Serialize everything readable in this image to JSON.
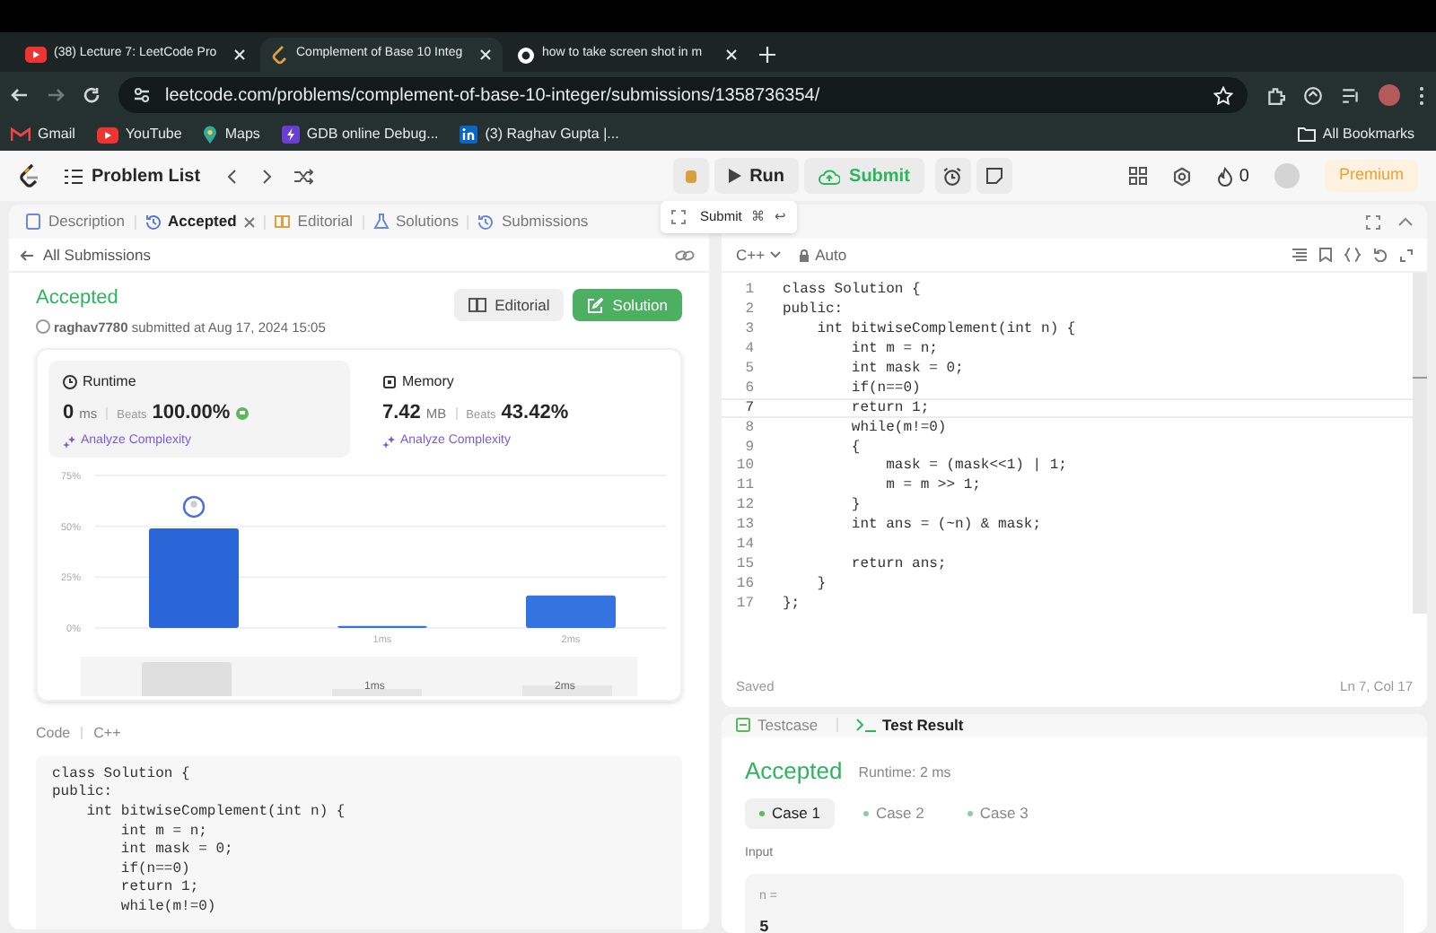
{
  "browser": {
    "tabs": [
      {
        "title": "(38) Lecture 7: LeetCode Pro",
        "kind": "video",
        "selected": false
      },
      {
        "title": "Complement of Base 10 Integ",
        "kind": "leetcode",
        "selected": true
      },
      {
        "title": "how to take screen shot in m",
        "kind": "search",
        "selected": false
      }
    ],
    "url": "leetcode.com/problems/complement-of-base-10-integer/submissions/1358736354/",
    "bookmarks": [
      {
        "label": "Gmail",
        "kind": "mail"
      },
      {
        "label": "YouTube",
        "kind": "video"
      },
      {
        "label": "Maps",
        "kind": "pin"
      },
      {
        "label": "GDB online Debug...",
        "kind": "bolt"
      },
      {
        "label": "(3) Raghav Gupta |...",
        "kind": "in"
      }
    ],
    "all_bookmarks": "All Bookmarks"
  },
  "navbar": {
    "problem_list": "Problem List",
    "run": "Run",
    "submit": "Submit",
    "streak": "0",
    "premium": "Premium"
  },
  "left_panel": {
    "tabs": [
      {
        "label": "Description",
        "selected": false,
        "closable": false
      },
      {
        "label": "Accepted",
        "selected": true,
        "closable": true
      },
      {
        "label": "Editorial",
        "selected": false,
        "closable": false
      },
      {
        "label": "Solutions",
        "selected": false,
        "closable": false
      },
      {
        "label": "Submissions",
        "selected": false,
        "closable": false
      }
    ],
    "back_link": "All Submissions",
    "status": "Accepted",
    "submitted": "**raghav7780** submitted at Aug 17, 2024 15:05",
    "buttons": [
      {
        "label": "Editorial",
        "kind": "secondary"
      },
      {
        "label": "Solution",
        "kind": "primary"
      }
    ],
    "stats": [
      {
        "title": "Runtime",
        "value": "0",
        "unit": "ms",
        "beats_label": "Beats",
        "beats": "100.00%",
        "analyze": "Analyze Complexity",
        "selected": true
      },
      {
        "title": "Memory",
        "value": "7.42",
        "unit": "MB",
        "beats_label": "Beats",
        "beats": "43.42%",
        "analyze": "Analyze Complexity",
        "selected": false
      }
    ],
    "chart_data": {
      "type": "bar",
      "categories": [
        null,
        "1ms",
        "2ms"
      ],
      "values": [
        49,
        1,
        16
      ],
      "ylim": [
        0,
        75
      ],
      "yticks": [
        {
          "value": 0,
          "label": "0%"
        },
        {
          "value": 25,
          "label": "25%"
        },
        {
          "value": 50,
          "label": "50%"
        },
        {
          "value": 75,
          "label": "75%"
        }
      ]
    },
    "range_labels": [
      "1ms",
      "2ms"
    ],
    "code_label": "Code",
    "language": "C++",
    "code": [
      "class Solution {",
      "public:",
      "    int bitwiseComplement(int n) {",
      "        int m = n;",
      "        int mask = 0;",
      "        if(n==0)",
      "        return 1;",
      "        while(m!=0)"
    ]
  },
  "tooltip": {
    "label": "Submit",
    "keys": [
      "⌘",
      "↩"
    ]
  },
  "editor": {
    "language": "C++",
    "mode": "Auto",
    "lines": [
      {
        "number": "1",
        "text": "class Solution {",
        "current": false
      },
      {
        "number": "2",
        "text": "public:",
        "current": false
      },
      {
        "number": "3",
        "text": "    int bitwiseComplement(int n) {",
        "current": false
      },
      {
        "number": "4",
        "text": "        int m = n;",
        "current": false
      },
      {
        "number": "5",
        "text": "        int mask = 0;",
        "current": false
      },
      {
        "number": "6",
        "text": "        if(n==0)",
        "current": false
      },
      {
        "number": "7",
        "text": "        return 1;",
        "current": true
      },
      {
        "number": "8",
        "text": "        while(m!=0)",
        "current": false
      },
      {
        "number": "9",
        "text": "        {",
        "current": false
      },
      {
        "number": "10",
        "text": "            mask = (mask<<1) | 1;",
        "current": false
      },
      {
        "number": "11",
        "text": "            m = m >> 1;",
        "current": false
      },
      {
        "number": "12",
        "text": "        }",
        "current": false
      },
      {
        "number": "13",
        "text": "        int ans = (~n) & mask;",
        "current": false
      },
      {
        "number": "14",
        "current": false
      },
      {
        "number": "15",
        "text": "        return ans;",
        "current": false
      },
      {
        "number": "16",
        "text": "    }",
        "current": false
      },
      {
        "number": "17",
        "text": "};",
        "current": false
      }
    ],
    "saved": "Saved",
    "cursor": "Ln 7, Col 17"
  },
  "console": {
    "tabs": [
      {
        "label": "Testcase",
        "selected": false
      },
      {
        "label": "Test Result",
        "selected": true
      }
    ],
    "status": "Accepted",
    "runtime": "Runtime: 2 ms",
    "cases": [
      {
        "label": "Case 1",
        "selected": true
      },
      {
        "label": "Case 2",
        "selected": false
      },
      {
        "label": "Case 3",
        "selected": false
      }
    ],
    "input_label": "Input",
    "input_name": "n =",
    "input_value": "5"
  }
}
